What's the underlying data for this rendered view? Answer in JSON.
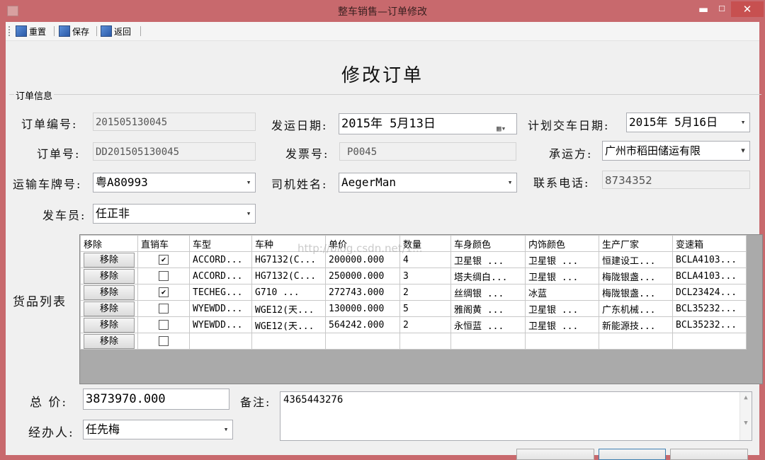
{
  "window": {
    "title": "整车销售—订单修改"
  },
  "toolbar": [
    {
      "label": "重置"
    },
    {
      "label": "保存"
    },
    {
      "label": "返回"
    }
  ],
  "form_title": "修改订单",
  "group_label": "订单信息",
  "fields": {
    "order_no": {
      "label": "订单编号:",
      "value": "201505130045"
    },
    "ship_date": {
      "label": "发运日期:",
      "value": "2015年 5月13日"
    },
    "plan_date": {
      "label": "计划交车日期:",
      "value": "2015年 5月16日"
    },
    "order_id": {
      "label": "订单号:",
      "value": "DD201505130045"
    },
    "invoice_no": {
      "label": "发票号:",
      "value": "P0045"
    },
    "carrier": {
      "label": "承运方:",
      "value": "广州市稻田储运有限"
    },
    "plate": {
      "label": "运输车牌号:",
      "value": "粤A80993"
    },
    "driver": {
      "label": "司机姓名:",
      "value": "AegerMan"
    },
    "phone": {
      "label": "联系电话:",
      "value": "8734352"
    },
    "dispatcher": {
      "label": "发车员:",
      "value": "任正非"
    },
    "goods_label": "货品列表",
    "total": {
      "label": "总  价:",
      "value": "3873970.000"
    },
    "remark": {
      "label": "备注:",
      "value": "4365443276"
    },
    "handler": {
      "label": "经办人:",
      "value": "任先梅"
    }
  },
  "goods": {
    "columns": [
      "移除",
      "直销车",
      "车型",
      "车种",
      "单价",
      "数量",
      "车身颜色",
      "内饰颜色",
      "生产厂家",
      "变速箱"
    ],
    "remove_label": "移除",
    "rows": [
      {
        "checked": true,
        "model": "ACCORD...",
        "kind": "HG7132(C...",
        "price": "200000.000",
        "qty": "4",
        "body": "卫星银   ...",
        "interior": "卫星银   ...",
        "maker": "恒建设工...",
        "gearbox": "BCLA4103..."
      },
      {
        "checked": false,
        "model": "ACCORD...",
        "kind": "HG7132(C...",
        "price": "250000.000",
        "qty": "3",
        "body": "塔夫绸白...",
        "interior": "卫星银   ...",
        "maker": "梅陇银盏...",
        "gearbox": "BCLA4103..."
      },
      {
        "checked": true,
        "model": "TECHEG...",
        "kind": "G710     ...",
        "price": "272743.000",
        "qty": "2",
        "body": "丝绸银   ...",
        "interior": "冰蓝",
        "maker": "梅陇银盏...",
        "gearbox": "DCL23424..."
      },
      {
        "checked": false,
        "model": "WYEWDD...",
        "kind": "WGE12(天...",
        "price": "130000.000",
        "qty": "5",
        "body": "雅阁黄   ...",
        "interior": "卫星银   ...",
        "maker": "广东机械...",
        "gearbox": "BCL35232..."
      },
      {
        "checked": false,
        "model": "WYEWDD...",
        "kind": "WGE12(天...",
        "price": "564242.000",
        "qty": "2",
        "body": "永恒蓝   ...",
        "interior": "卫星银   ...",
        "maker": "新能源技...",
        "gearbox": "BCL35232..."
      },
      {
        "checked": false,
        "model": "",
        "kind": "",
        "price": "",
        "qty": "",
        "body": "",
        "interior": "",
        "maker": "",
        "gearbox": ""
      }
    ]
  },
  "watermark": "http://blog.csdn.net/1...",
  "icons": {
    "toolbar_icon": "image-icon",
    "dropdown": "chevron-down-icon",
    "calendar": "calendar-icon"
  },
  "colors": {
    "titlebar": "#c8696d",
    "close_button": "#c75050",
    "grid_background": "#aaaaaa"
  }
}
